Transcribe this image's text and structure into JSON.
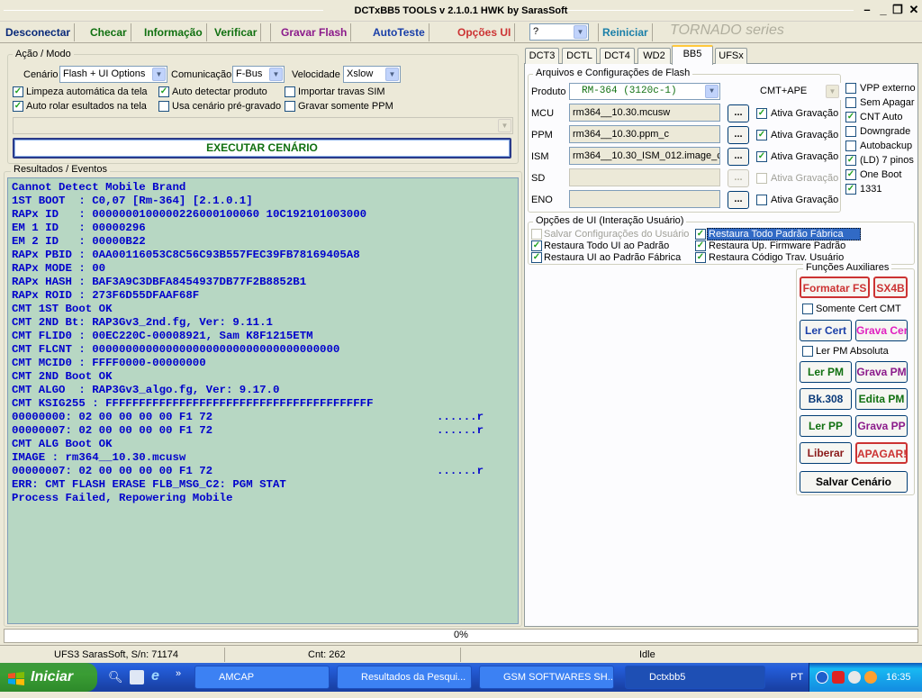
{
  "window": {
    "title": "DCTxBB5 TOOLS v 2.1.0.1 HWK by SarasSoft"
  },
  "menu": {
    "desconectar": "Desconectar",
    "checar": "Checar",
    "informacao": "Informação",
    "verificar": "Verificar",
    "gravar_flash": "Gravar Flash",
    "autoteste": "AutoTeste",
    "opcoes_ui": "Opções UI",
    "help_combo": "?",
    "reiniciar": "Reiniciar",
    "series": "TORNADO series"
  },
  "acao_modo": {
    "title": "Ação / Modo",
    "cenario_label": "Cenário",
    "cenario_value": "Flash + UI Options",
    "comunicacao_label": "Comunicação",
    "comunicacao_value": "F-Bus",
    "velocidade_label": "Velocidade",
    "velocidade_value": "Xslow",
    "checks": [
      {
        "label": "Limpeza automática da tela",
        "checked": true
      },
      {
        "label": "Auto detectar produto",
        "checked": true
      },
      {
        "label": "Importar travas SIM",
        "checked": false
      },
      {
        "label": "Auto rolar esultados na tela",
        "checked": true
      },
      {
        "label": "Usa cenário pré-gravado",
        "checked": false
      },
      {
        "label": "Gravar somente PPM",
        "checked": false
      }
    ],
    "execute_button": "EXECUTAR CENÁRIO"
  },
  "results": {
    "title": "Resultados / Eventos",
    "lines": [
      "Cannot Detect Mobile Brand",
      "1ST BOOT  : C0,07 [Rm-364] [2.1.0.1]",
      "RAPx ID   : 0000000100000226000100060 10C192101003000",
      "EM 1 ID   : 00000296",
      "EM 2 ID   : 00000B22",
      "RAPx PBID : 0AA00116053C8C56C93B557FEC39FB78169405A8",
      "RAPx MODE : 00",
      "RAPx HASH : BAF3A9C3DBFA8454937DB77F2B8852B1",
      "RAPx ROID : 273F6D55DFAAF68F",
      "CMT 1ST Boot OK",
      "CMT 2ND Bt: RAP3Gv3_2nd.fg, Ver: 9.11.1",
      "CMT FLID0 : 00EC220C-00008921, Sam K8F1215ETM",
      "CMT FLCNT : 0000000000000000000000000000000000000",
      "CMT MCID0 : FFFF0000-00000000",
      "CMT 2ND Boot OK",
      "CMT ALGO  : RAP3Gv3_algo.fg, Ver: 9.17.0",
      "CMT KSIG255 : FFFFFFFFFFFFFFFFFFFFFFFFFFFFFFFFFFFFFFFF",
      "00000000: 02 00 00 00 00 F1 72",
      "00000007: 02 00 00 00 00 F1 72",
      "CMT ALG Boot OK",
      "IMAGE : rm364__10.30.mcusw",
      "00000007: 02 00 00 00 00 F1 72",
      "ERR: CMT FLASH ERASE FLB_MSG_C2: PGM STAT",
      "Process Failed, Repowering Mobile"
    ],
    "line_suffixes": {
      "17": "......r",
      "18": "......r",
      "21": "......r"
    }
  },
  "tabs": [
    "DCT3",
    "DCTL",
    "DCT4",
    "WD2",
    "BB5",
    "UFSx"
  ],
  "bb5": {
    "files_title": "Arquivos e Configurações de Flash",
    "produto_label": "Produto",
    "produto_value": "RM-364  (3120c-1)",
    "cmt_value": "CMT+APE",
    "mcu_label": "MCU",
    "mcu_value": "rm364__10.30.mcusw",
    "ppm_label": "PPM",
    "ppm_value": "rm364__10.30.ppm_c",
    "ism_label": "ISM",
    "ism_value": "rm364__10.30_ISM_012.image_c",
    "sd_label": "SD",
    "eno_label": "ENO",
    "dots": "...",
    "ativa_label": "Ativa Gravação",
    "right_checks": [
      {
        "label": "VPP externo",
        "checked": false
      },
      {
        "label": "Sem Apagar",
        "checked": false
      },
      {
        "label": "CNT Auto",
        "checked": true
      },
      {
        "label": "Downgrade",
        "checked": false
      },
      {
        "label": "Autobackup",
        "checked": false
      },
      {
        "label": "(LD) 7 pinos",
        "checked": true
      },
      {
        "label": "One Boot",
        "checked": true
      },
      {
        "label": "1331",
        "checked": true
      }
    ],
    "ui_title": "Opções de UI (Interação Usuário)",
    "ui_checks": [
      {
        "label": "Salvar Configurações do Usuário",
        "checked": false
      },
      {
        "label": "Restaura Todo Padrão Fábrica",
        "checked": true
      },
      {
        "label": "Restaura Todo UI ao Padrão",
        "checked": true
      },
      {
        "label": "Restaura Up. Firmware Padrão",
        "checked": true
      },
      {
        "label": "Restaura UI ao Padrão Fábrica",
        "checked": true
      },
      {
        "label": "Restaura Código Trav. Usuário",
        "checked": true
      }
    ],
    "aux_title": "Funções Auxiliares",
    "btn_formatar": "Formatar FS",
    "btn_sx4b": "SX4B",
    "somente_cert": "Somente Cert CMT",
    "btn_ler_cert": "Ler Cert",
    "btn_grava_cert": "Grava Cert",
    "ler_pm_abs": "Ler PM Absoluta",
    "btn_ler_pm": "Ler PM",
    "btn_grava_pm": "Grava PM",
    "btn_bk308": "Bk.308",
    "btn_edita_pm": "Edita PM",
    "btn_ler_pp": "Ler PP",
    "btn_grava_pp": "Grava PP",
    "btn_liberar": "Liberar",
    "btn_apagar": "APAGAR!",
    "btn_salvar": "Salvar Cenário"
  },
  "progress": {
    "text": "0%",
    "value": 0
  },
  "status": {
    "left": "UFS3 SarasSoft, S/n: 71174",
    "cnt": "Cnt: 262",
    "state": "Idle"
  },
  "taskbar": {
    "start": "Iniciar",
    "tasks": [
      "AMCAP",
      "Resultados da Pesqui...",
      "GSM SOFTWARES SH...",
      "Dctxbb5"
    ],
    "lang": "PT",
    "clock": "16:35"
  }
}
